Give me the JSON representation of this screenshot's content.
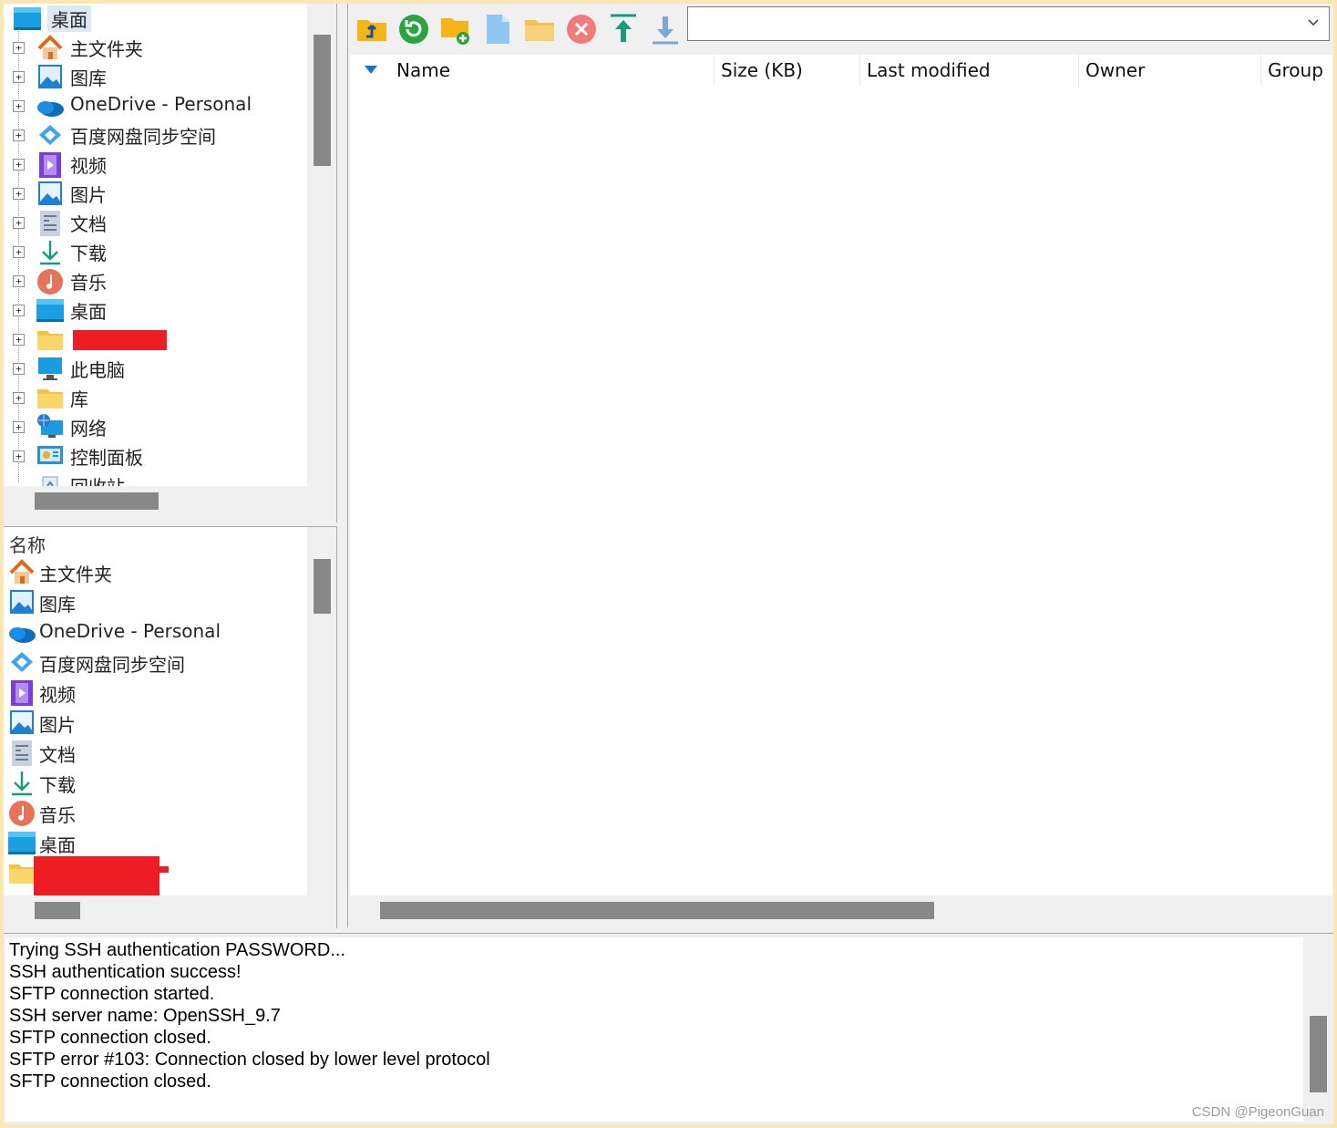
{
  "tree": {
    "root_label": "桌面",
    "items": [
      {
        "label": "主文件夹",
        "icon": "home-icon"
      },
      {
        "label": "图库",
        "icon": "gallery-icon"
      },
      {
        "label": "OneDrive - Personal",
        "icon": "onedrive-cloud-icon"
      },
      {
        "label": "百度网盘同步空间",
        "icon": "baidu-netdisk-icon"
      },
      {
        "label": "视频",
        "icon": "video-folder-icon"
      },
      {
        "label": "图片",
        "icon": "pictures-folder-icon"
      },
      {
        "label": "文档",
        "icon": "documents-folder-icon"
      },
      {
        "label": "下载",
        "icon": "download-arrow-icon"
      },
      {
        "label": "音乐",
        "icon": "music-note-icon"
      },
      {
        "label": "桌面",
        "icon": "desktop-folder-icon"
      },
      {
        "label": "",
        "icon": "folder-icon"
      },
      {
        "label": "此电脑",
        "icon": "computer-icon"
      },
      {
        "label": "库",
        "icon": "library-folder-icon"
      },
      {
        "label": "网络",
        "icon": "network-icon"
      },
      {
        "label": "控制面板",
        "icon": "control-panel-icon"
      },
      {
        "label": "回收站",
        "icon": "recycle-bin-icon"
      }
    ]
  },
  "local_list": {
    "header": "名称",
    "items": [
      {
        "label": "主文件夹"
      },
      {
        "label": "图库"
      },
      {
        "label": "OneDrive - Personal"
      },
      {
        "label": "百度网盘同步空间"
      },
      {
        "label": "视频"
      },
      {
        "label": "图片"
      },
      {
        "label": "文档"
      },
      {
        "label": "下载"
      },
      {
        "label": "音乐"
      },
      {
        "label": "桌面"
      },
      {
        "label": ""
      }
    ]
  },
  "toolbar": {
    "buttons": [
      {
        "name": "parent-folder-button",
        "icon": "folder-up-icon"
      },
      {
        "name": "refresh-button",
        "icon": "refresh-icon"
      },
      {
        "name": "new-folder-button",
        "icon": "folder-add-icon"
      },
      {
        "name": "new-file-button",
        "icon": "file-icon"
      },
      {
        "name": "open-folder-button",
        "icon": "folder-open-icon"
      },
      {
        "name": "delete-button",
        "icon": "close-circle-icon"
      },
      {
        "name": "upload-button",
        "icon": "upload-arrow-icon"
      },
      {
        "name": "download-button",
        "icon": "download-arrow-icon"
      }
    ],
    "path_value": ""
  },
  "remote_columns": [
    "Name",
    "Size (KB)",
    "Last modified",
    "Owner",
    "Group"
  ],
  "log": {
    "lines": [
      "Trying SSH authentication PASSWORD...",
      "SSH authentication success!",
      "SFTP connection started.",
      "SSH server name: OpenSSH_9.7",
      "SFTP connection closed.",
      "SFTP error #103: Connection closed by lower level protocol",
      "SFTP connection closed."
    ]
  },
  "watermark": "CSDN @PigeonGuan",
  "colors": {
    "frame": "#fbe7b4",
    "redaction": "#ee1c25",
    "scroll_thumb": "#888888",
    "selected_bg": "#dde8f5"
  }
}
